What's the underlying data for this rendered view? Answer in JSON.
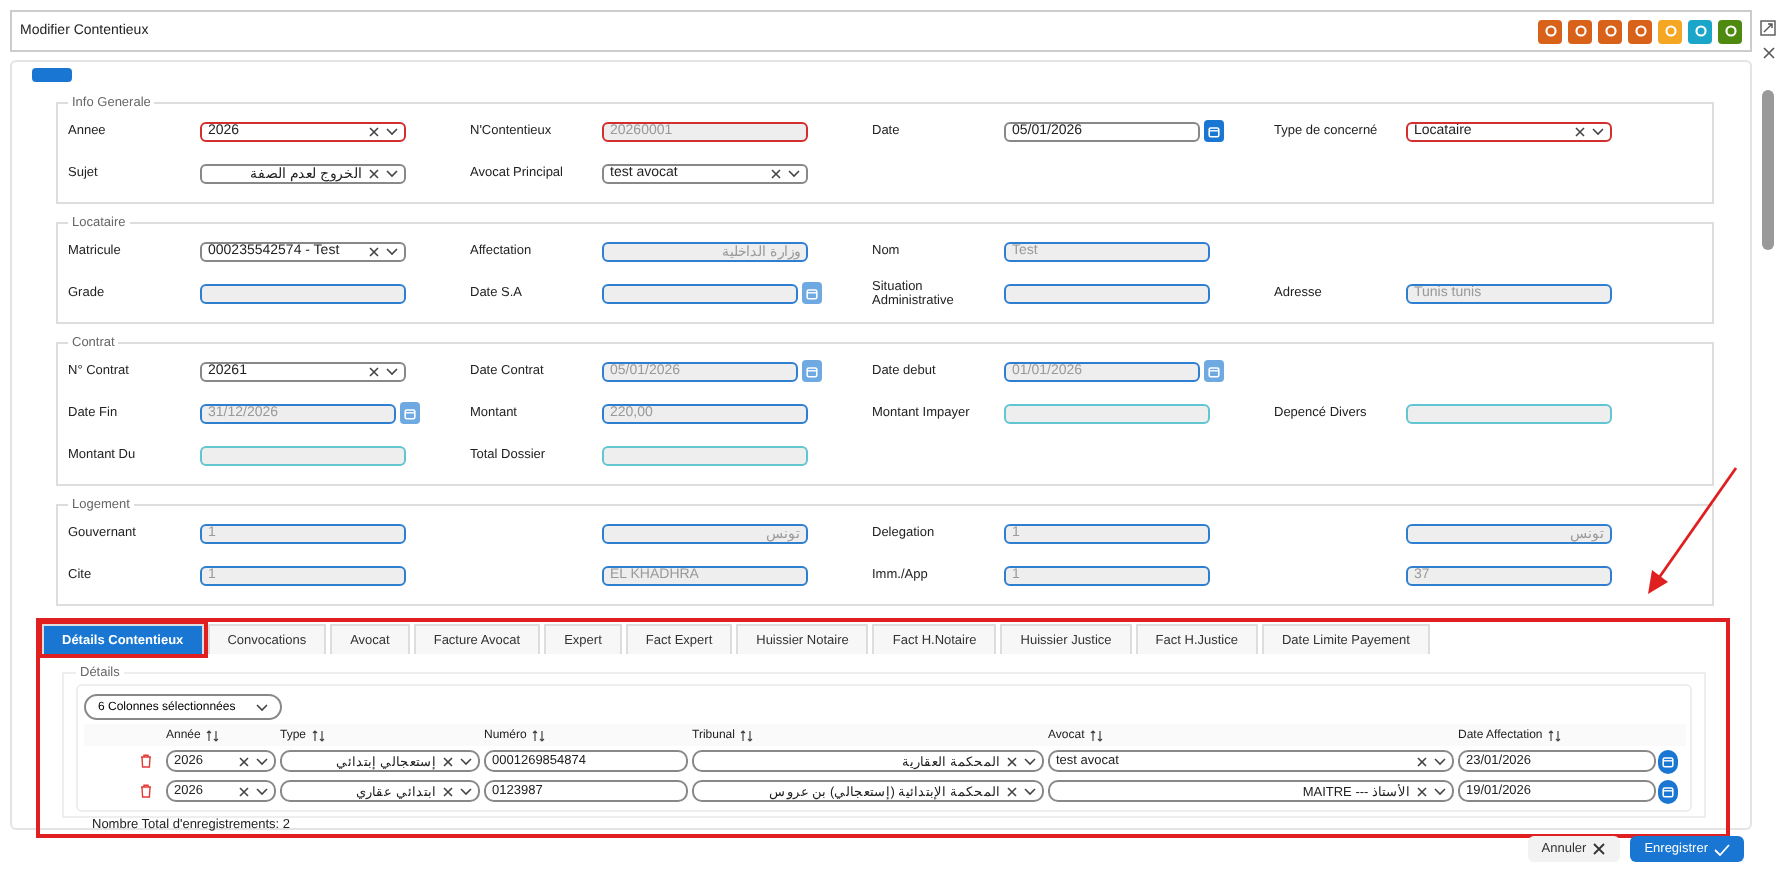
{
  "window": {
    "title": "Modifier Contentieux",
    "actions": [
      {
        "color": "#d9621a"
      },
      {
        "color": "#d9621a"
      },
      {
        "color": "#d9621a"
      },
      {
        "color": "#d9621a"
      },
      {
        "color": "#f5a623"
      },
      {
        "color": "#1aa6c9"
      },
      {
        "color": "#4f8a10"
      }
    ]
  },
  "sections": [
    {
      "title": "Info Generale",
      "rows": [
        [
          {
            "kind": "select",
            "label": "Annee",
            "value": "2026",
            "color": "#d32f2f",
            "disabled": false
          },
          {
            "kind": "text",
            "label": "N'Contentieux",
            "value": "20260001",
            "color": "#d32f2f",
            "disabled": true
          },
          {
            "kind": "date",
            "label": "Date",
            "value": "05/01/2026",
            "color": "#888888",
            "disabled": false
          },
          {
            "kind": "select",
            "label": "Type de concerné",
            "value": "Locataire",
            "color": "#d32f2f",
            "disabled": false
          }
        ],
        [
          {
            "kind": "select",
            "label": "Sujet",
            "value": "الخروج لعدم الصفة",
            "color": "#888888",
            "disabled": false
          },
          {
            "kind": "select",
            "label": "Avocat Principal",
            "value": "test avocat",
            "color": "#888888",
            "disabled": false
          },
          {
            "kind": "empty"
          },
          {
            "kind": "empty"
          }
        ]
      ]
    },
    {
      "title": "Locataire",
      "rows": [
        [
          {
            "kind": "select",
            "label": "Matricule",
            "value": "000235542574 - Test",
            "color": "#888888",
            "disabled": false
          },
          {
            "kind": "text",
            "label": "Affectation",
            "value": "وزارة الداخلية",
            "color": "#2f7fd1",
            "disabled": true
          },
          {
            "kind": "text",
            "label": "Nom",
            "value": "Test",
            "color": "#2f7fd1",
            "disabled": true
          },
          {
            "kind": "empty"
          }
        ],
        [
          {
            "kind": "text",
            "label": "Grade",
            "color": "#2f7fd1",
            "disabled": true
          },
          {
            "kind": "date",
            "label": "Date S.A",
            "color": "#2f7fd1",
            "disabled": true
          },
          {
            "kind": "text",
            "label": "Situation Administrative",
            "color": "#2f7fd1",
            "disabled": true
          },
          {
            "kind": "text",
            "label": "Adresse",
            "value": "Tunis tunis",
            "color": "#2f7fd1",
            "disabled": true
          }
        ]
      ]
    },
    {
      "title": "Contrat",
      "rows": [
        [
          {
            "kind": "select",
            "label": "N° Contrat",
            "value": "20261",
            "color": "#888888",
            "disabled": false
          },
          {
            "kind": "date",
            "label": "Date Contrat",
            "value": "05/01/2026",
            "color": "#2f7fd1",
            "disabled": true
          },
          {
            "kind": "date",
            "label": "Date debut",
            "value": "01/01/2026",
            "color": "#2f7fd1",
            "disabled": true
          },
          {
            "kind": "empty"
          }
        ],
        [
          {
            "kind": "date",
            "label": "Date Fin",
            "value": "31/12/2026",
            "color": "#2f7fd1",
            "disabled": true
          },
          {
            "kind": "text",
            "label": "Montant",
            "value": "220,00",
            "color": "#2f7fd1",
            "disabled": true
          },
          {
            "kind": "text",
            "label": "Montant Impayer",
            "color": "#62c6d2",
            "disabled": true
          },
          {
            "kind": "text",
            "label": "Depencé Divers",
            "color": "#62c6d2",
            "disabled": true
          }
        ],
        [
          {
            "kind": "text",
            "label": "Montant Du",
            "color": "#62c6d2",
            "disabled": true
          },
          {
            "kind": "text",
            "label": "Total Dossier",
            "color": "#62c6d2",
            "disabled": true
          },
          {
            "kind": "empty"
          },
          {
            "kind": "empty"
          }
        ]
      ]
    },
    {
      "title": "Logement",
      "rows": [
        [
          {
            "kind": "text",
            "label": "Gouvernant",
            "value": "1",
            "color": "#2f7fd1",
            "disabled": true
          },
          {
            "kind": "text",
            "value": "تونس",
            "color": "#2f7fd1",
            "disabled": true
          },
          {
            "kind": "text",
            "label": "Delegation",
            "value": "1",
            "color": "#2f7fd1",
            "disabled": true
          },
          {
            "kind": "text",
            "value": "تونس",
            "color": "#2f7fd1",
            "disabled": true
          }
        ],
        [
          {
            "kind": "text",
            "label": "Cite",
            "value": "1",
            "color": "#2f7fd1",
            "disabled": true
          },
          {
            "kind": "text",
            "value": "EL KHADHRA",
            "color": "#2f7fd1",
            "disabled": true
          },
          {
            "kind": "text",
            "label": "Imm./App",
            "value": "1",
            "color": "#2f7fd1",
            "disabled": true
          },
          {
            "kind": "text",
            "value": "37",
            "color": "#2f7fd1",
            "disabled": true
          }
        ]
      ]
    }
  ],
  "tabs": [
    {
      "label": "Détails Contentieux",
      "selected": true
    },
    {
      "label": "Convocations",
      "selected": false
    },
    {
      "label": "Avocat",
      "selected": false
    },
    {
      "label": "Facture Avocat",
      "selected": false
    },
    {
      "label": "Expert",
      "selected": false
    },
    {
      "label": "Fact Expert",
      "selected": false
    },
    {
      "label": "Huissier Notaire",
      "selected": false
    },
    {
      "label": "Fact H.Notaire",
      "selected": false
    },
    {
      "label": "Huissier Justice",
      "selected": false
    },
    {
      "label": "Fact H.Justice",
      "selected": false
    },
    {
      "label": "Date Limite Payement",
      "selected": false
    }
  ],
  "details": {
    "title": "Détails",
    "column_picker": "6 Colonnes sélectionnées",
    "columns": [
      "Année",
      "Type",
      "Numéro",
      "Tribunal",
      "Avocat",
      "Date Affectation"
    ],
    "rows": [
      [
        {
          "kind": "select",
          "value": "2026"
        },
        {
          "kind": "select",
          "value": "إستعجالي إبتدائي"
        },
        {
          "kind": "text",
          "value": "0001269854874"
        },
        {
          "kind": "select",
          "value": "المحكمة العقارية"
        },
        {
          "kind": "select",
          "value": "test avocat"
        },
        {
          "kind": "date",
          "value": "23/01/2026"
        }
      ],
      [
        {
          "kind": "select",
          "value": "2026"
        },
        {
          "kind": "select",
          "value": "ابتدائي عقاري"
        },
        {
          "kind": "text",
          "value": "0123987"
        },
        {
          "kind": "select",
          "value": "المحكمة الإبتدائية (إستعجالي) بن عروس"
        },
        {
          "kind": "select",
          "value": "الأستاذ --- MAITRE"
        },
        {
          "kind": "date",
          "value": "19/01/2026"
        }
      ]
    ],
    "total": "Nombre Total d'enregistrements: 2"
  },
  "buttons": [
    {
      "label": "Annuler",
      "kind": "cancel"
    },
    {
      "label": "Enregistrer",
      "kind": "save"
    }
  ]
}
